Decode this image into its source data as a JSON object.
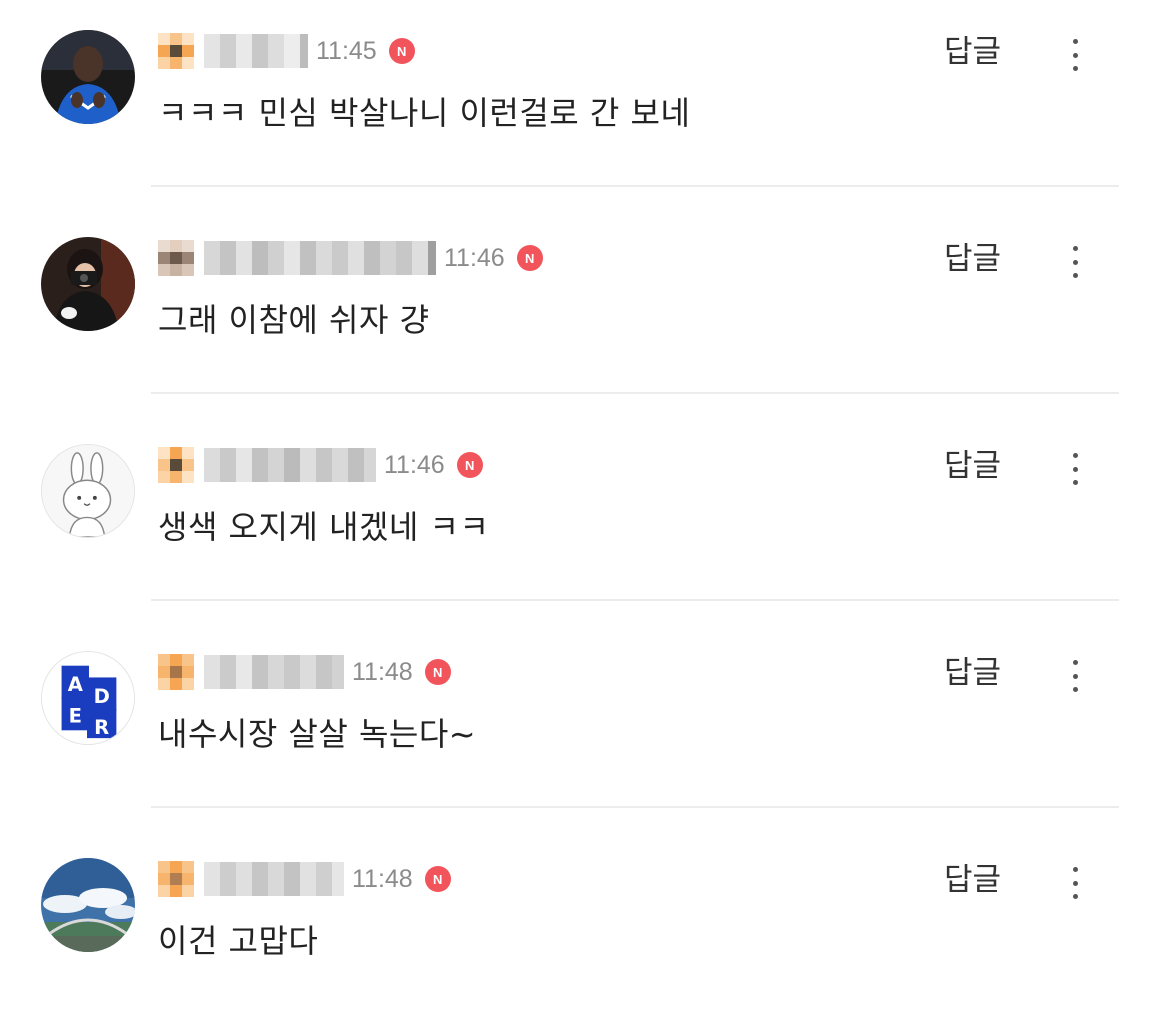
{
  "colors": {
    "time_text": "#8b8b8b",
    "new_badge": "#f2545b",
    "divider": "#ececec",
    "body_text": "#222222"
  },
  "icons": {
    "new": "new-badge-icon",
    "more": "more-vertical-icon"
  },
  "comments": [
    {
      "time": "11:45",
      "new_badge": "N",
      "text": "ㅋㅋㅋ 민심 박살나니 이런걸로 간 보네",
      "reply_label": "답글",
      "avatar": "photo-football-player"
    },
    {
      "time": "11:46",
      "new_badge": "N",
      "text": "그래 이참에 쉬자 걍",
      "reply_label": "답글",
      "avatar": "photo-person-camera"
    },
    {
      "time": "11:46",
      "new_badge": "N",
      "text": "생색 오지게 내겠네 ㅋㅋ",
      "reply_label": "답글",
      "avatar": "illustration-rabbit"
    },
    {
      "time": "11:48",
      "new_badge": "N",
      "text": "내수시장 살살 녹는다~",
      "reply_label": "답글",
      "avatar": "logo-ader"
    },
    {
      "time": "11:48",
      "new_badge": "N",
      "text": "이건 고맙다",
      "reply_label": "답글",
      "avatar": "photo-sky-bridge"
    }
  ],
  "ader_logo": {
    "letters": [
      "A",
      "D",
      "E",
      "R"
    ]
  }
}
